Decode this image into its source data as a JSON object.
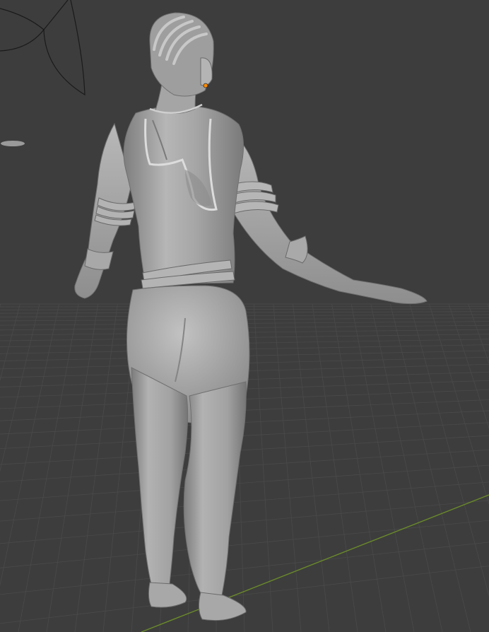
{
  "viewport": {
    "background": "#3d3d3d",
    "grid_color": "#4a4a4a",
    "grid_major_color": "#545454",
    "x_axis_color": "#6a8a2a",
    "view": "perspective",
    "mode": "sculpt"
  },
  "scene": {
    "object": "character-mesh",
    "object_color": "#a9a9a9",
    "shadow_color": "#6f6f6f",
    "highlight_color": "#d2d2d2",
    "origin_color": "#ff8c00",
    "camera": "camera-wireframe",
    "light": "light-object"
  }
}
